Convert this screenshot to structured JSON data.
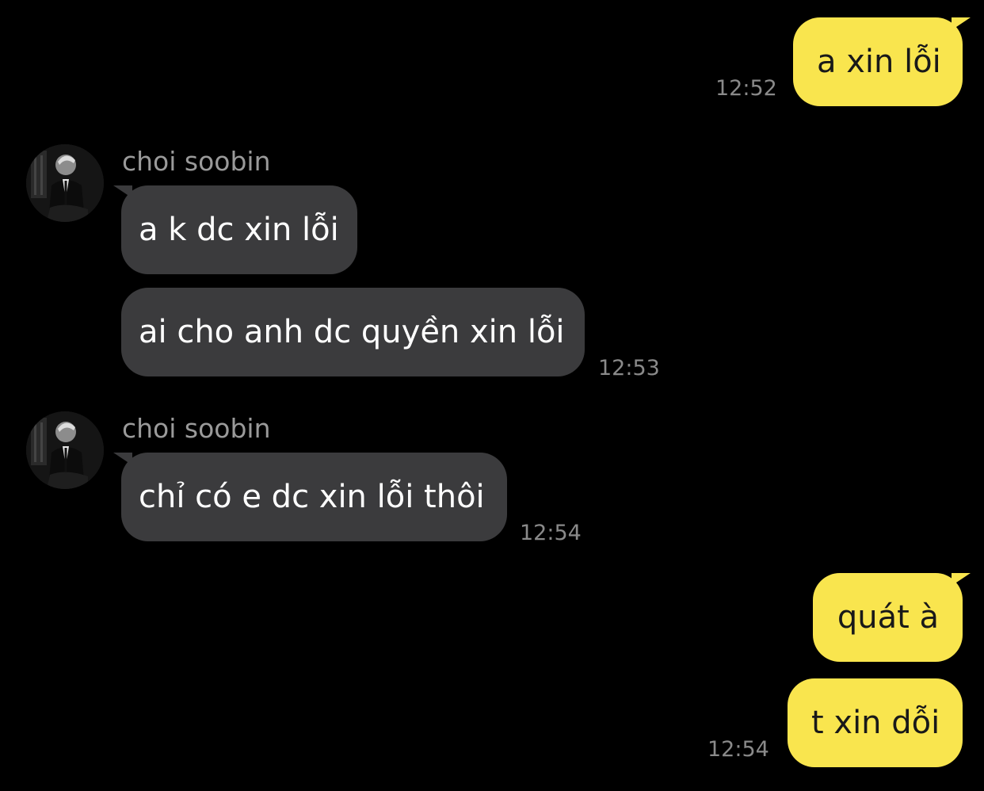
{
  "colors": {
    "background": "#000000",
    "outgoing_bubble": "#f9e54e",
    "incoming_bubble": "#3b3b3d",
    "timestamp": "#8a8a8a",
    "sender_name": "#9a9a9a"
  },
  "messages": {
    "m1": {
      "text": "a xin lỗi",
      "time": "12:52"
    },
    "g1": {
      "sender": "choi soobin",
      "m2": {
        "text": "a k dc xin lỗi"
      },
      "m3": {
        "text": "ai cho anh dc quyền xin lỗi",
        "time": "12:53"
      }
    },
    "g2": {
      "sender": "choi soobin",
      "m4": {
        "text": "chỉ có e dc xin lỗi thôi",
        "time": "12:54"
      }
    },
    "m5": {
      "text": "quát à"
    },
    "m6": {
      "text": "t xin dỗi",
      "time": "12:54"
    }
  },
  "icons": {
    "avatar": "profile-photo-icon"
  }
}
